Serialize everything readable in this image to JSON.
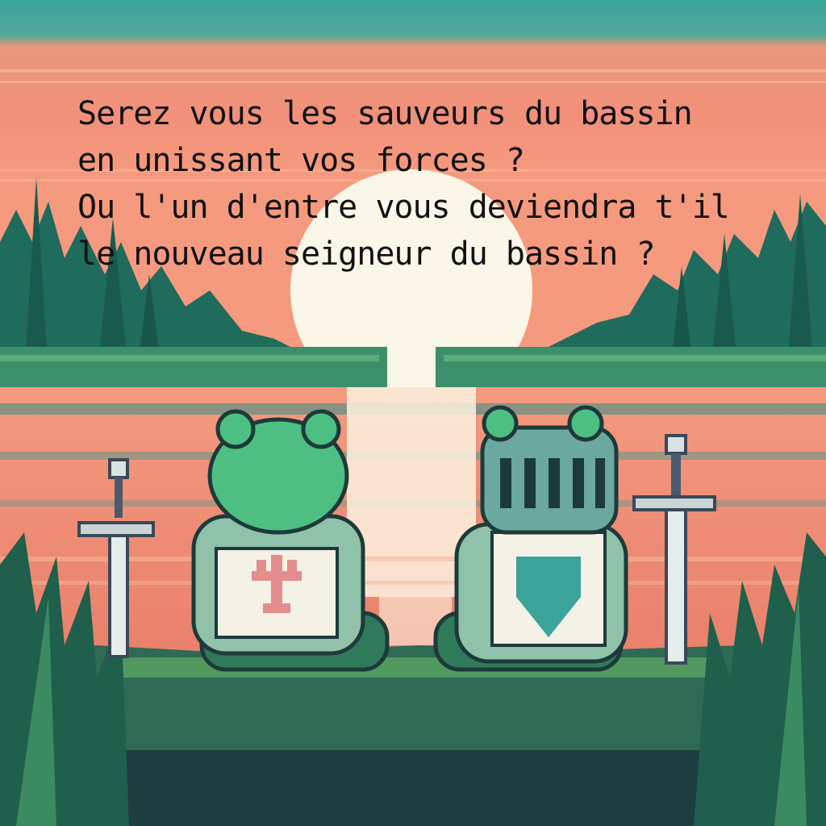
{
  "caption": {
    "line1": "Serez vous les sauveurs du bassin",
    "line2": "en unissant vos forces ?",
    "line3": "Ou l'un d'entre vous deviendra t'il",
    "line4": "le nouveau seigneur du bassin ?"
  },
  "colors": {
    "sky_top": "#3aa39a",
    "sky_band": "#f29277",
    "sun": "#fbf7e8",
    "trees": "#1f6b5c",
    "water": "#f09a82",
    "frog": "#4dbf82",
    "armor": "#6aa8a0",
    "ground": "#2f6a55",
    "text": "#111111"
  },
  "icons": {
    "left_sword": "sword-icon",
    "right_sword": "sword-icon",
    "left_crest": "fleur-de-lis-icon",
    "right_crest": "shield-icon"
  }
}
